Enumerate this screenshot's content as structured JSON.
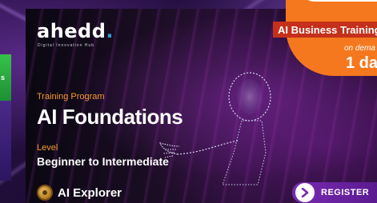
{
  "brand": {
    "name": "ahedd",
    "dot": ".",
    "tagline": "Digital Innovation Hub"
  },
  "left_card": {
    "text": "s"
  },
  "course": {
    "program_label": "Training Program",
    "title": "AI Foundations",
    "level_label": "Level",
    "level_value": "Beginner to Intermediate",
    "badge_text": "AI Explorer"
  },
  "promo": {
    "pill": "AI Business Training",
    "on_demand": "on dema",
    "duration": "1 da"
  },
  "cta": {
    "register_label": "REGISTER"
  },
  "colors": {
    "accent_orange": "#f5781e",
    "label_orange": "#f59a2a",
    "pill_red": "#c4301b",
    "register_purple": "#7a2ab0",
    "logo_dot_blue": "#2e9bd8"
  },
  "icons": {
    "badge": "medal-icon",
    "register": "chevron-right-icon"
  }
}
